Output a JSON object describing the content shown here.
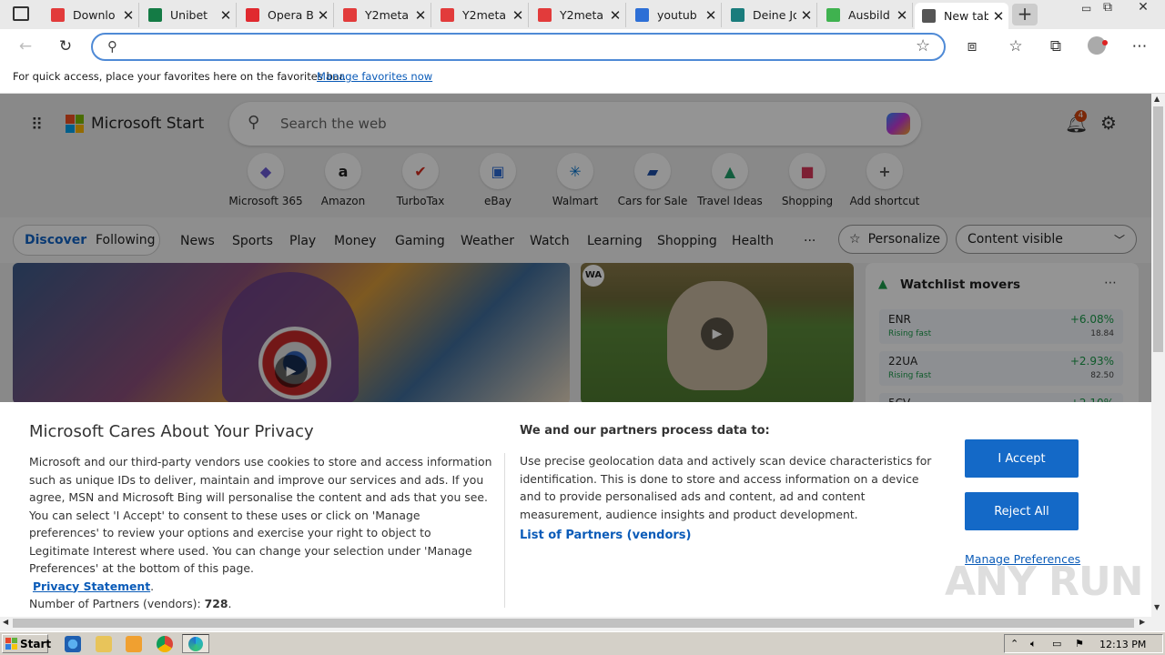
{
  "tabs": [
    {
      "title": "Downlo",
      "icon": "download-icon",
      "color": "#e23b3b"
    },
    {
      "title": "Unibet",
      "icon": "unibet-icon",
      "color": "#147b45"
    },
    {
      "title": "Opera B",
      "icon": "opera-icon",
      "color": "#e0292f"
    },
    {
      "title": "Y2meta",
      "icon": "download-icon",
      "color": "#e23b3b"
    },
    {
      "title": "Y2meta",
      "icon": "download-icon",
      "color": "#e23b3b"
    },
    {
      "title": "Y2meta",
      "icon": "download-icon",
      "color": "#e23b3b"
    },
    {
      "title": "youtub",
      "icon": "search-icon",
      "color": "#2d6fd6"
    },
    {
      "title": "Deine Jo",
      "icon": "xing-icon",
      "color": "#1a7c7c"
    },
    {
      "title": "Ausbild",
      "icon": "g-icon",
      "color": "#3fb24f"
    },
    {
      "title": "New tab",
      "icon": "newtab-icon",
      "color": "#555555"
    }
  ],
  "favbar": {
    "text": "For quick access, place your favorites here on the favorites bar.",
    "link": "Manage favorites now"
  },
  "msn": {
    "logo_text": "Microsoft Start",
    "search_placeholder": "Search the web",
    "notif_count": "4",
    "shortcuts": [
      {
        "label": "Microsoft 365",
        "glyph": "◆",
        "color": "#6b5bd6"
      },
      {
        "label": "Amazon",
        "glyph": "a",
        "color": "#222222"
      },
      {
        "label": "TurboTax",
        "glyph": "✔",
        "color": "#d52b1e"
      },
      {
        "label": "eBay",
        "glyph": "▣",
        "color": "#2b6bd6"
      },
      {
        "label": "Walmart",
        "glyph": "✳",
        "color": "#0071ce"
      },
      {
        "label": "Cars for Sale",
        "glyph": "▰",
        "color": "#1c4fa8"
      },
      {
        "label": "Travel Ideas",
        "glyph": "▲",
        "color": "#1fa06b"
      },
      {
        "label": "Shopping",
        "glyph": "■",
        "color": "#d8375a"
      },
      {
        "label": "Add shortcut",
        "glyph": "+",
        "color": "#555555"
      }
    ],
    "pill": {
      "discover": "Discover",
      "following": "Following"
    },
    "nav": [
      "News",
      "Sports",
      "Play",
      "Money",
      "Gaming",
      "Weather",
      "Watch",
      "Learning",
      "Shopping",
      "Health",
      "···"
    ],
    "personalize": "Personalize",
    "content_visible": "Content visible",
    "watchlist": {
      "title": "Watchlist movers",
      "rows": [
        {
          "sym": "ENR",
          "sub": "Rising fast",
          "chg": "+6.08%",
          "price": "18.84"
        },
        {
          "sym": "22UA",
          "sub": "Rising fast",
          "chg": "+2.93%",
          "price": "82.50"
        },
        {
          "sym": "5CV",
          "sub": "",
          "chg": "+2.10%",
          "price": ""
        }
      ]
    },
    "badge": "WA"
  },
  "privacy": {
    "title": "Microsoft Cares About Your Privacy",
    "body": "Microsoft and our third-party vendors use cookies to store and access information such as unique IDs to deliver, maintain and improve our services and ads. If you agree, MSN and Microsoft Bing will personalise the content and ads that you see. You can select 'I Accept' to consent to these uses or click on 'Manage preferences' to review your options and exercise your right to object to Legitimate Interest where used.  You can change your selection under 'Manage Preferences' at the bottom of this page.",
    "privacy_link": "Privacy Statement",
    "partners_label": "Number of Partners (vendors):",
    "partners_count": "728",
    "right_title": "We and our partners process data to:",
    "right_body": "Use precise geolocation data and actively scan device characteristics for identification. This is done to store and access information on a device and to provide personalised ads and content, ad and content measurement, audience insights and product development.",
    "list_link": "List of Partners (vendors)",
    "accept": "I Accept",
    "reject": "Reject All",
    "manage": "Manage Preferences"
  },
  "taskbar": {
    "start": "Start",
    "time": "12:13 PM"
  },
  "watermark": "ANY RUN"
}
